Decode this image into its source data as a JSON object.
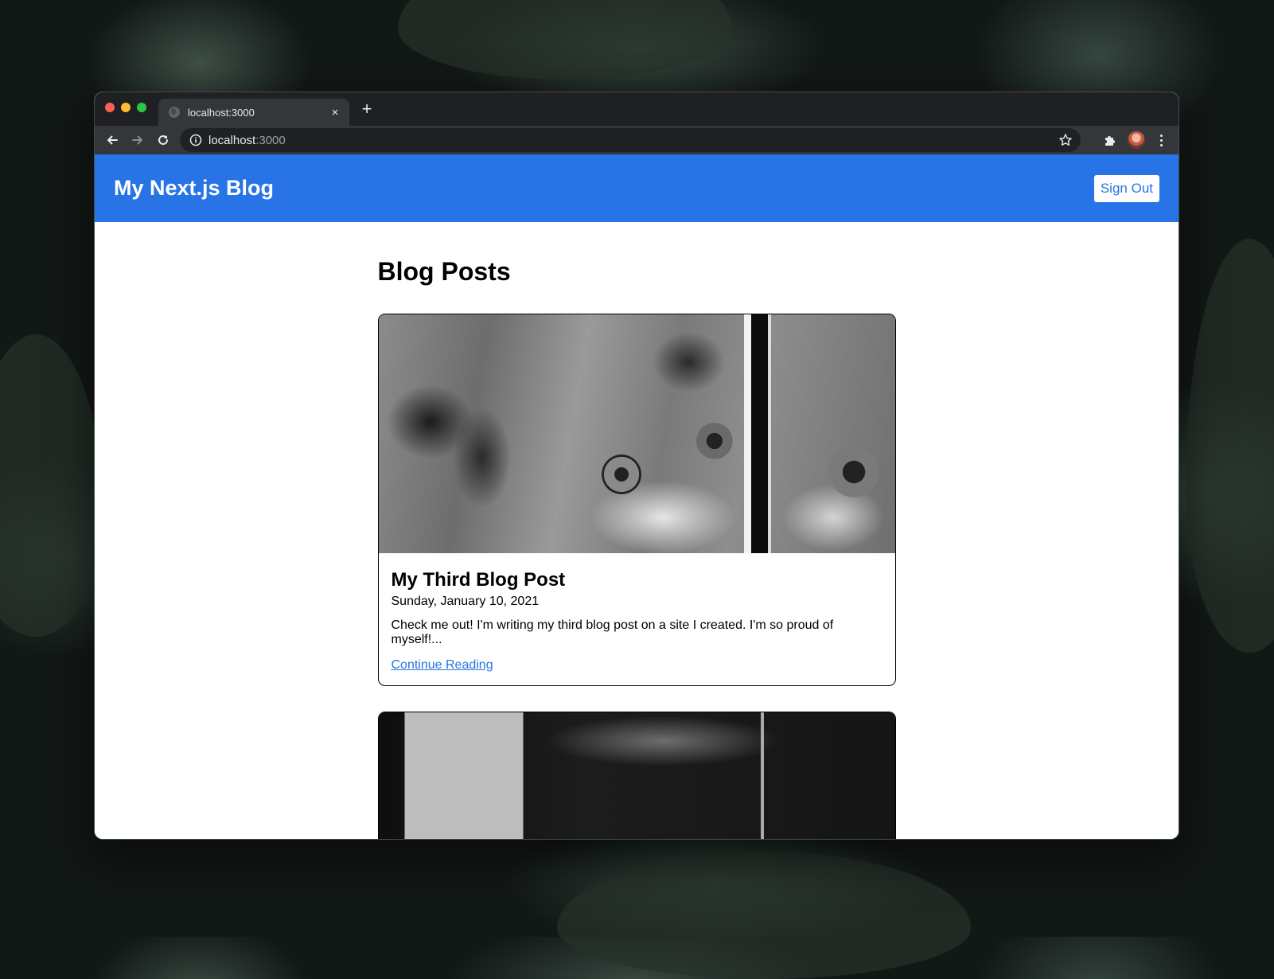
{
  "browser": {
    "tab_title": "localhost:3000",
    "tab_close": "×",
    "new_tab": "+",
    "url_host": "localhost",
    "url_port": ":3000"
  },
  "site": {
    "title": "My Next.js Blog",
    "sign_out_label": "Sign Out",
    "accent_color": "#2874e6"
  },
  "main": {
    "heading": "Blog Posts",
    "posts": [
      {
        "title": "My Third Blog Post",
        "date": "Sunday, January 10, 2021",
        "excerpt": "Check me out! I'm writing my third blog post on a site I created. I'm so proud of myself!...",
        "link_label": "Continue Reading",
        "image": "kitten-face-photo"
      },
      {
        "image": "kitten-scratching-post-photo"
      }
    ]
  }
}
